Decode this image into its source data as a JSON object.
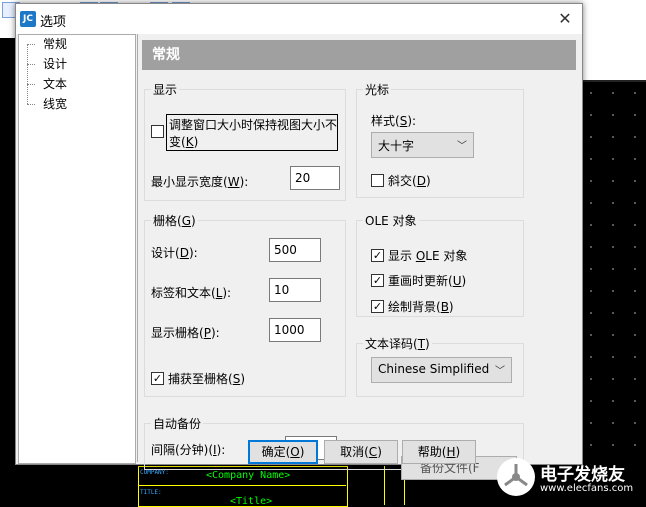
{
  "dialog": {
    "title": "选项",
    "app_icon": "JC",
    "close_glyph": "✕"
  },
  "tree": {
    "items": [
      "常规",
      "设计",
      "文本",
      "线宽"
    ]
  },
  "panel": {
    "header": "常规"
  },
  "display": {
    "title": "显示",
    "keep_view_line1": "调整窗口大小时保持视图大小不",
    "keep_view_line2_pre": "变(",
    "keep_view_key": "K",
    "keep_view_line2_post": ")",
    "keep_view_checked": false,
    "min_width_pre": "最小显示宽度(",
    "min_width_key": "W",
    "min_width_post": "):",
    "min_width_value": "20"
  },
  "cursor": {
    "title": "光标",
    "style_pre": "样式(",
    "style_key": "S",
    "style_post": "):",
    "style_value": "大十字",
    "italic_pre": "斜交(",
    "italic_key": "D",
    "italic_post": ")",
    "italic_checked": false
  },
  "grid": {
    "title_pre": "栅格(",
    "title_key": "G",
    "title_post": ")",
    "design_pre": "设计(",
    "design_key": "D",
    "design_post": "):",
    "design_value": "500",
    "label_pre": "标签和文本(",
    "label_key": "L",
    "label_post": "):",
    "label_value": "10",
    "show_pre": "显示栅格(",
    "show_key": "P",
    "show_post": "):",
    "show_value": "1000",
    "snap_pre": "捕获至栅格(",
    "snap_key": "S",
    "snap_post": ")",
    "snap_checked": true
  },
  "ole": {
    "title": "OLE 对象",
    "show_pre": "显示 ",
    "show_key": "O",
    "show_post": "LE 对象",
    "show_checked": true,
    "redraw_pre": "重画时更新(",
    "redraw_key": "U",
    "redraw_post": ")",
    "redraw_checked": true,
    "bg_pre": "绘制背景(",
    "bg_key": "B",
    "bg_post": ")",
    "bg_checked": true
  },
  "encoding": {
    "title_pre": "文本译码(",
    "title_key": "T",
    "title_post": ")",
    "value": "Chinese Simplified"
  },
  "autosave": {
    "title": "自动备份",
    "interval_pre": "间隔(分钟)(",
    "interval_key": "I",
    "interval_post": "):",
    "backup_btn": "备份文件(F"
  },
  "buttons": {
    "ok_pre": "确定(",
    "ok_key": "O",
    "ok_post": ")",
    "cancel_pre": "取消(",
    "cancel_key": "C",
    "cancel_post": ")",
    "help_pre": "帮助(",
    "help_key": "H",
    "help_post": ")"
  },
  "background": {
    "company_name": "<Company Name>",
    "title_field": "<Title>"
  },
  "watermark": {
    "line1": "电子发烧友",
    "line2": "www.elecfans.com"
  },
  "colors": {
    "header_bg": "#a0a0a0",
    "focus_blue": "#0078d7",
    "schematic_green": "#00ff00",
    "schematic_yellow": "#ffff00"
  }
}
